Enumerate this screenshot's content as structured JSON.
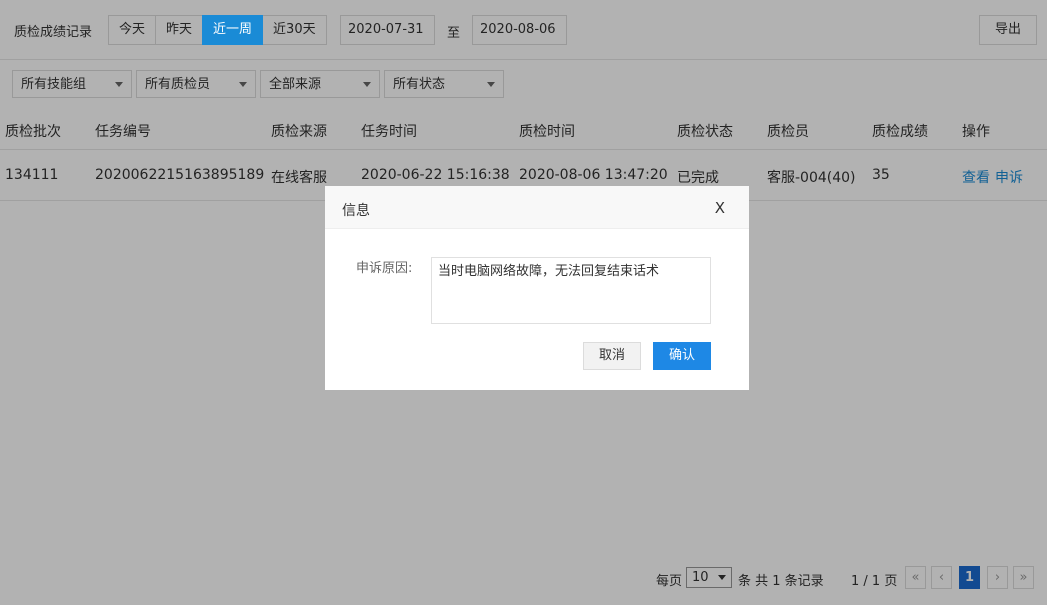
{
  "toolbar": {
    "title": "质检成绩记录",
    "ranges": [
      "今天",
      "昨天",
      "近一周",
      "近30天"
    ],
    "active_range": "近一周",
    "date_from": "2020-07-31",
    "date_sep": "至",
    "date_to": "2020-08-06",
    "export_label": "导出"
  },
  "filters": [
    "所有技能组",
    "所有质检员",
    "全部来源",
    "所有状态"
  ],
  "table": {
    "headers": [
      "质检批次",
      "任务编号",
      "质检来源",
      "任务时间",
      "质检时间",
      "质检状态",
      "质检员",
      "质检成绩",
      "操作"
    ],
    "rows": [
      {
        "batch": "134111",
        "task_no": "2020062215163895189",
        "source": "在线客服",
        "task_time": "2020-06-22 15:16:38",
        "qc_time": "2020-08-06 13:47:20",
        "status": "已完成",
        "inspector": "客服-004(40)",
        "score": "35",
        "actions": [
          "查看",
          "申诉"
        ]
      }
    ]
  },
  "pager": {
    "per_page_label": "每页",
    "per_page": "10",
    "total_text": "条 共 1 条记录",
    "page_info": "1 / 1 页",
    "first": "«",
    "prev": "‹",
    "current": "1",
    "next": "›",
    "last": "»"
  },
  "modal": {
    "title": "信息",
    "close": "X",
    "field_label": "申诉原因:",
    "reason": "当时电脑网络故障，无法回复结束话术",
    "cancel": "取消",
    "confirm": "确认"
  },
  "colors": {
    "accent": "#1a8bd6",
    "confirm": "#1e88e5",
    "overlay": "rgba(0,0,0,0.3)"
  }
}
